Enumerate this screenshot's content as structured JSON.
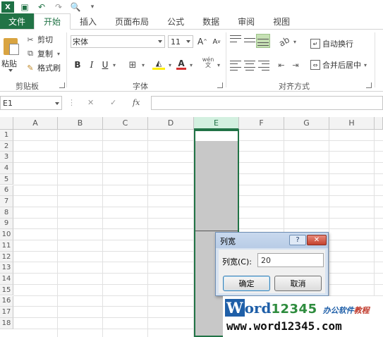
{
  "app": {
    "logo": "X"
  },
  "quick_access": {
    "save_icon": "save-icon",
    "undo_icon": "undo-icon",
    "redo_icon": "redo-icon",
    "preview_icon": "print-preview-icon"
  },
  "tabs": [
    "文件",
    "开始",
    "插入",
    "页面布局",
    "公式",
    "数据",
    "审阅",
    "视图"
  ],
  "active_tab": "开始",
  "ribbon": {
    "clipboard": {
      "paste": "粘贴",
      "cut": "剪切",
      "copy": "复制",
      "format_painter": "格式刷",
      "group_label": "剪贴板"
    },
    "font": {
      "font_name": "宋体",
      "font_size": "11",
      "bold": "B",
      "italic": "I",
      "underline": "U",
      "grow": "A",
      "shrink": "A",
      "wen": "wén",
      "group_label": "字体"
    },
    "alignment": {
      "wrap_text": "自动换行",
      "merge_center": "合并后居中",
      "group_label": "对齐方式"
    }
  },
  "formula_bar": {
    "name_box": "E1",
    "fx": "fx",
    "formula": ""
  },
  "columns": [
    "A",
    "B",
    "C",
    "D",
    "E",
    "F",
    "G",
    "H"
  ],
  "selected_column": "E",
  "rows": [
    "1",
    "2",
    "3",
    "4",
    "5",
    "6",
    "7",
    "8",
    "9",
    "10",
    "11",
    "12",
    "13",
    "14",
    "15",
    "16",
    "17",
    "18"
  ],
  "dialog": {
    "title": "列宽",
    "help": "?",
    "close": "✕",
    "label": "列宽(C):",
    "value": "20",
    "ok": "确定",
    "cancel": "取消"
  },
  "watermark": {
    "brand_w": "W",
    "brand_ord": "ord",
    "brand_num": "12345",
    "tagline_a": "办公软件",
    "tagline_b": "教程",
    "url": "www.word12345.com"
  },
  "colors": {
    "excel_green": "#217346",
    "selection_gray": "#c8c8c8",
    "dialog_blue": "#d7e3f1",
    "close_red": "#c3422e"
  }
}
